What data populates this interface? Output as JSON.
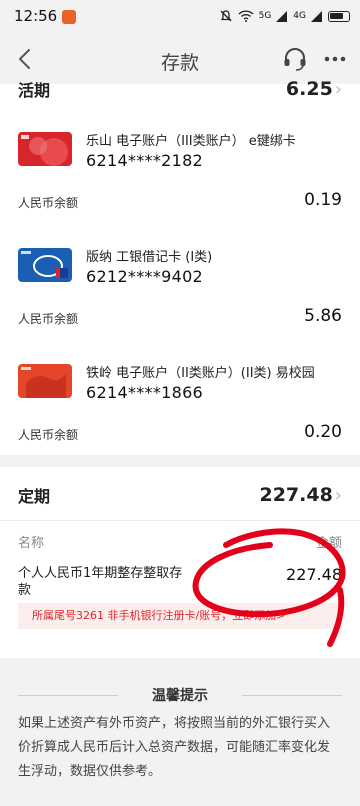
{
  "status_bar": {
    "time": "12:56",
    "signal_5g": "5G",
    "signal_4g": "4G"
  },
  "nav": {
    "title": "存款"
  },
  "current": {
    "label": "活期",
    "amount": "6.25"
  },
  "accounts": [
    {
      "name": "乐山 电子账户（III类账户） e键绑卡",
      "number": "6214****2182",
      "balance_label": "人民币余额",
      "balance": "0.19"
    },
    {
      "name": "版纳 工银借记卡 (I类)",
      "number": "6212****9402",
      "balance_label": "人民币余额",
      "balance": "5.86"
    },
    {
      "name": "铁岭 电子账户（II类账户）(II类) 易校园",
      "number": "6214****1866",
      "balance_label": "人民币余额",
      "balance": "0.20"
    }
  ],
  "fixed": {
    "label": "定期",
    "amount": "227.48",
    "col_name": "名称",
    "col_amount": "金额",
    "product_line1": "个人人民币1年期整存整取存",
    "product_line2": "款",
    "product_amount": "227.48",
    "notice": "所属尾号3261 非手机银行注册卡/账号，立即添加>"
  },
  "tips": {
    "title": "温馨提示",
    "body": "如果上述资产有外币资产，将按照当前的外汇银行买入价折算成人民币后计入总资产数据，可能随汇率变化发生浮动，数据仅供参考。"
  },
  "colors": {
    "accent_red": "#e0242a",
    "notice_bg": "#fdeeee",
    "page_bg": "#f2f2f2"
  }
}
